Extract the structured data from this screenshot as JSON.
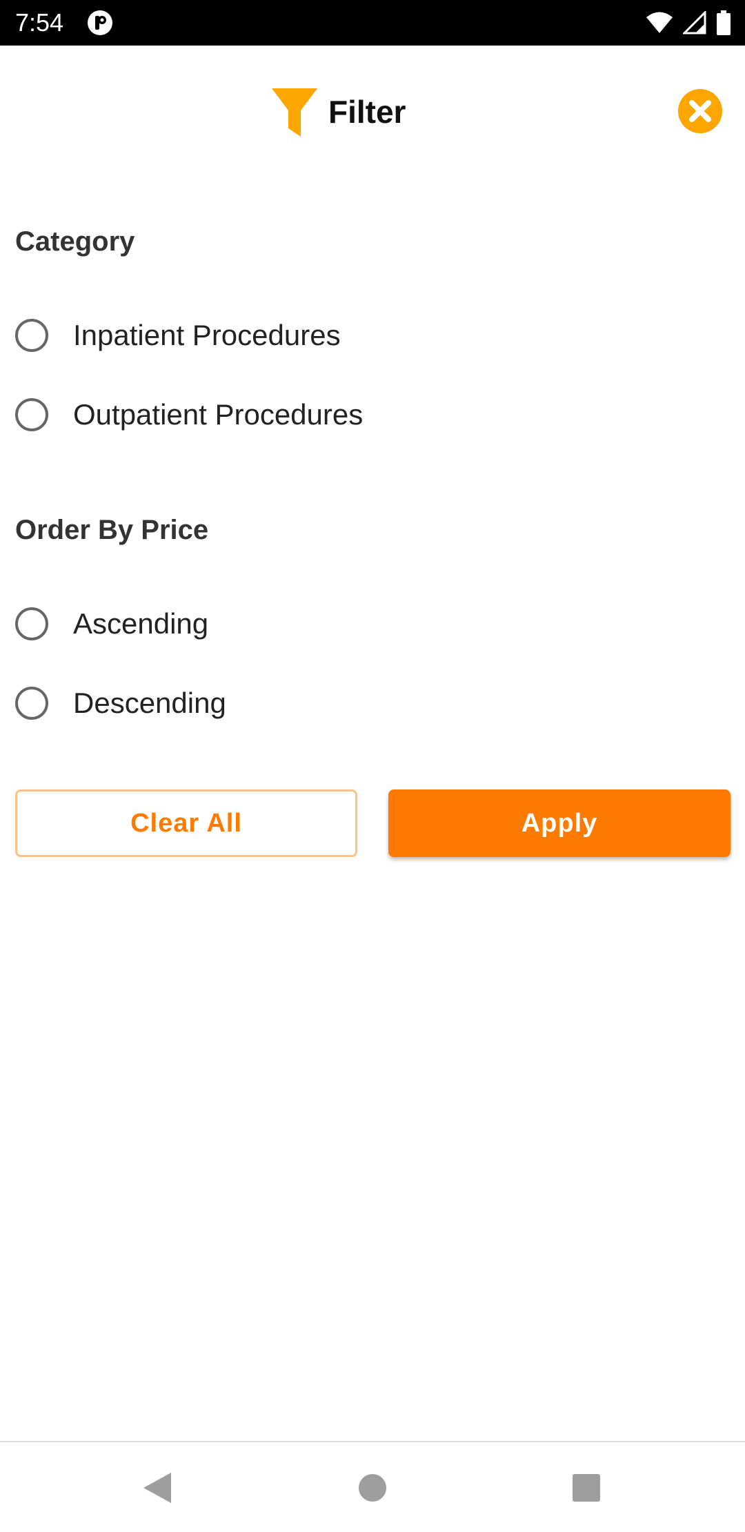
{
  "status_bar": {
    "time": "7:54",
    "icons": [
      "app-notification-icon",
      "wifi-icon",
      "signal-icon",
      "battery-icon"
    ]
  },
  "header": {
    "title": "Filter",
    "filter_icon": "filter-funnel-icon",
    "close_icon": "close-circle-icon"
  },
  "sections": {
    "category": {
      "title": "Category",
      "options": [
        "Inpatient Procedures",
        "Outpatient Procedures"
      ],
      "selected": null
    },
    "order_by_price": {
      "title": "Order By Price",
      "options": [
        "Ascending",
        "Descending"
      ],
      "selected": null
    }
  },
  "actions": {
    "clear_label": "Clear All",
    "apply_label": "Apply"
  },
  "nav_bar": {
    "icons": [
      "back-triangle-icon",
      "home-circle-icon",
      "recents-square-icon"
    ]
  },
  "colors": {
    "accent": "#ff7a00",
    "accent_light": "#ffc085",
    "icon_yellow": "#ffa500",
    "status_bar": "#000000",
    "text_primary": "#222222",
    "radio_border": "#666666"
  }
}
